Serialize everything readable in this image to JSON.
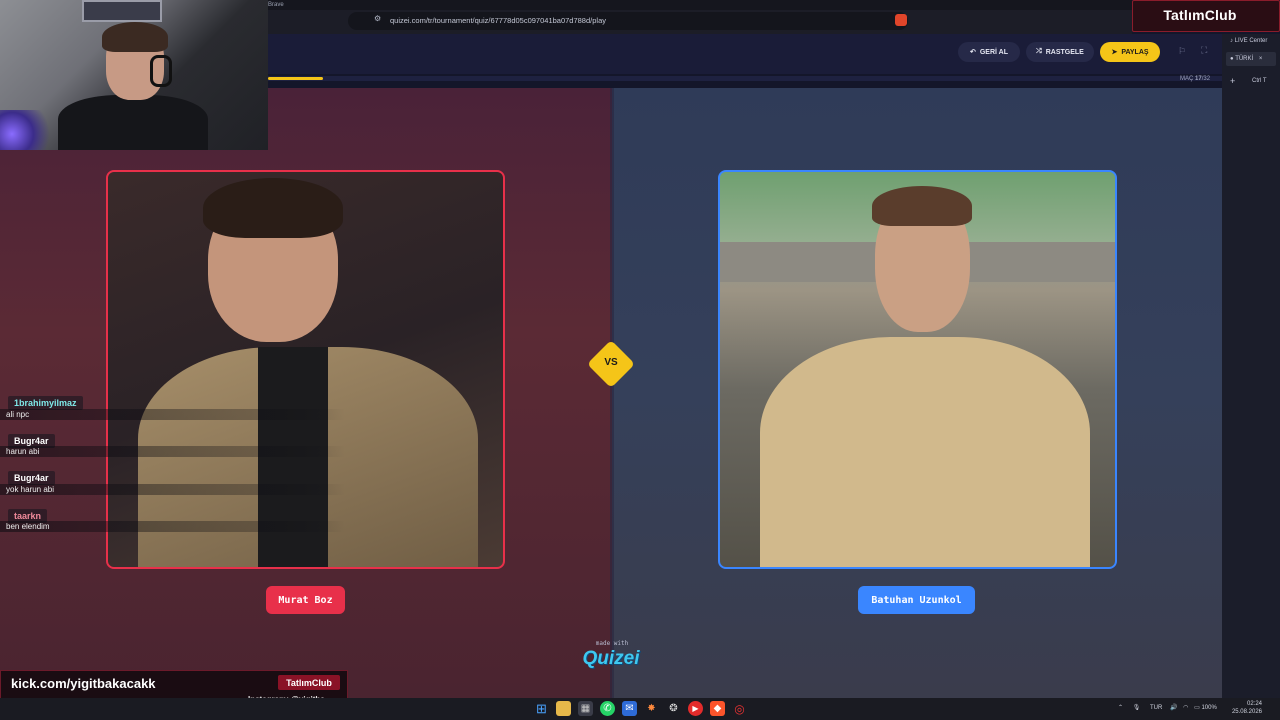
{
  "browser": {
    "brand": "Brave",
    "url": "quizei.com/tr/tournament/quiz/67778d05c097041ba07d788d/play"
  },
  "overlay": {
    "top_right_title": "TatlımClub",
    "kick_url": "kick.com/yigitbakacakk",
    "badge": "TatlımClub",
    "instagram": "Instagram: @yigitba"
  },
  "header": {
    "undo_label": "GERİ AL",
    "random_label": "RASTGELE",
    "share_label": "PAYLAŞ",
    "match_label": "MAÇ",
    "match_current": "17",
    "match_total": "/32",
    "progress_fraction": 0.058
  },
  "sidepanel": {
    "live_center": "LIVE Center",
    "lang": "TÜRKİ",
    "plus": "+",
    "shortcut": "Ctrl T"
  },
  "arena": {
    "vs": "VS",
    "left_name": "Murat Boz",
    "right_name": "Batuhan Uzunkol",
    "made_with": "made with",
    "logo": "Quizei"
  },
  "chat": [
    {
      "user": "1brahimyilmaz",
      "message": "ali npc",
      "color": "#7ee8e8"
    },
    {
      "user": "Bugr4ar",
      "message": "harun abi",
      "color": "#ffffff"
    },
    {
      "user": "Bugr4ar",
      "message": "yok harun abi",
      "color": "#ffffff"
    },
    {
      "user": "taarkn",
      "message": "ben elendim",
      "color": "#f08a9a"
    }
  ],
  "taskbar": {
    "lang": "TUR",
    "battery": "100%",
    "time": "02:24",
    "date": "25.08.2026"
  },
  "colors": {
    "accent_yellow": "#f5c518",
    "left_accent": "#e8304a",
    "right_accent": "#3a86ff"
  }
}
